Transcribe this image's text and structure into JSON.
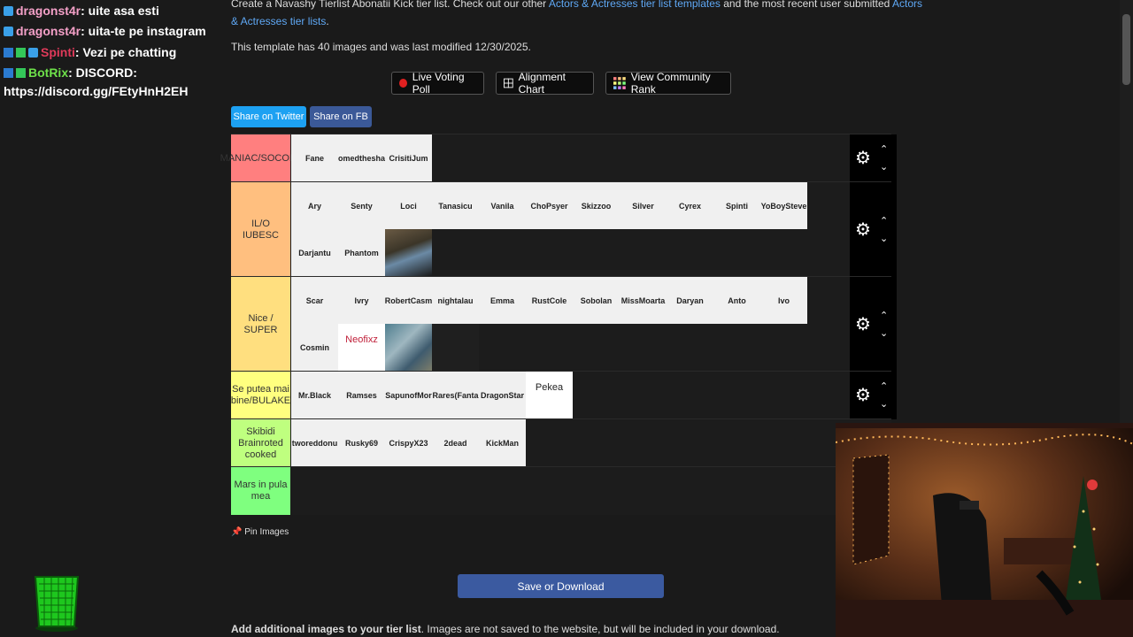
{
  "chat": {
    "messages": [
      {
        "user": "dragonst4r",
        "text": ": uite asa esti",
        "user_color": "#f4a0c8"
      },
      {
        "user": "dragonst4r",
        "text": ": uita-te pe instagram",
        "user_color": "#f4a0c8"
      },
      {
        "user": "Spinti",
        "text": ": Vezi pe chatting",
        "user_color": "#e03a5a"
      },
      {
        "user": "BotRix",
        "text": ": DISCORD:",
        "user_color": "#6ee14a",
        "text2": "https://discord.gg/FEtyHnH2EH"
      }
    ]
  },
  "page": {
    "intro_line1_prefix": "Create a Navashy Tierlist Abonatii Kick tier list. Check out our other ",
    "intro_link1": "Actors & Actresses tier list templates",
    "intro_line1_mid": " and the most recent user submitted ",
    "intro_link2a": "Actors",
    "intro_link2b": "& Actresses tier lists",
    "intro_end": ".",
    "modified": "This template has 40 images and was last modified 12/30/2025."
  },
  "toolbar": {
    "live_voting": "Live Voting Poll",
    "alignment": "Alignment Chart",
    "community": "View Community Rank"
  },
  "share": {
    "twitter": "Share on Twitter",
    "fb": "Share on FB"
  },
  "tiers": [
    {
      "label": "MANIAC/SOCOLA",
      "color": "#ff7f7f",
      "items": [
        "Fane",
        "omedthesha",
        "CrisitiJum"
      ]
    },
    {
      "label": "IL/O IUBESC",
      "color": "#ffbf7f",
      "items": [
        "Ary",
        "Senty",
        "Loci",
        "Tanasicu",
        "Vanila",
        "ChoPsyer",
        "Skizzoo",
        "Silver",
        "Cyrex",
        "Spinti",
        "YoBoySteve",
        "Darjantu",
        "Phantom",
        ""
      ]
    },
    {
      "label": "Nice / SUPER",
      "color": "#ffdf7f",
      "items": [
        "Scar",
        "Ivry",
        "RobertCasm",
        "nightalau",
        "Emma",
        "RustCole",
        "Sobolan",
        "MissMoarta",
        "Daryan",
        "Anto",
        "Ivo",
        "Cosmin",
        "Neofixz",
        "",
        ""
      ]
    },
    {
      "label": "Se putea mai bine/BULAKE",
      "color": "#ffff7f",
      "items": [
        "Mr.Black",
        "Ramses",
        "SapunofMor",
        "Rares(Fanta",
        "DragonStar",
        "Pekea"
      ]
    },
    {
      "label": "Skibidi Brainroted cooked",
      "color": "#bfff7f",
      "items": [
        "tworeddonu",
        "Rusky69",
        "CrispyX23",
        "2dead",
        "KickMan"
      ]
    },
    {
      "label": "Mars in pula mea",
      "color": "#7fff7f",
      "items": []
    }
  ],
  "pin_label": "Pin Images",
  "save_label": "Save or Download",
  "add_bold": "Add additional images to your tier list",
  "add_rest": ". Images are not saved to the website, but will be included in your download."
}
